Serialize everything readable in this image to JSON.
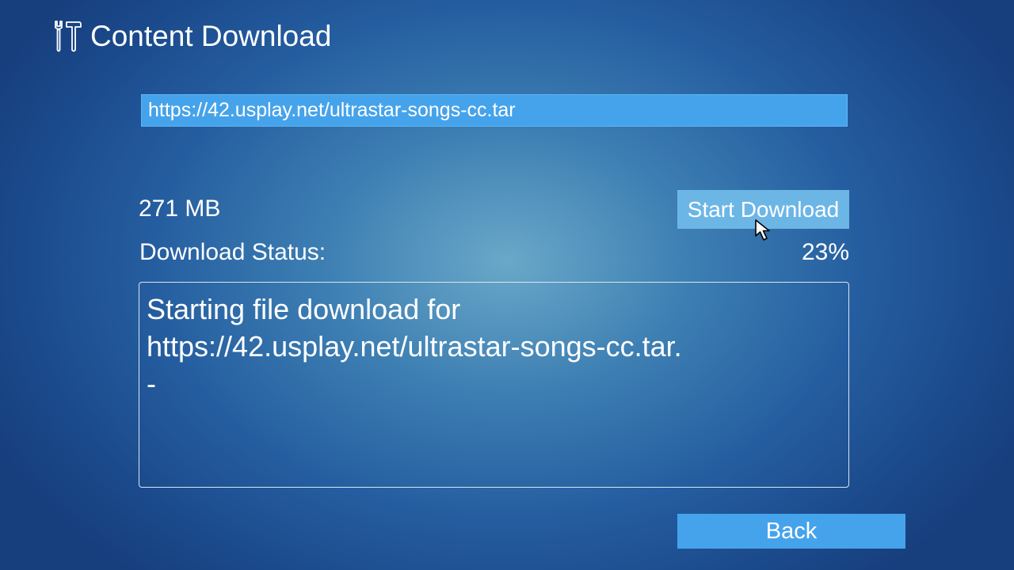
{
  "header": {
    "icon": "tools-icon",
    "title": "Content Download"
  },
  "download": {
    "url_value": "https://42.usplay.net/ultrastar-songs-cc.tar",
    "size": "271 MB",
    "start_label": "Start Download",
    "status_label": "Download Status:",
    "progress_text": "23%",
    "progress_value": 0.23,
    "log_text": "Starting file download for\nhttps://42.usplay.net/ultrastar-songs-cc.tar.\n-"
  },
  "footer": {
    "back_label": "Back"
  },
  "colors": {
    "accent": "#45a3eb",
    "button_highlight": "#6cb6e6",
    "background_center": "#6aa8c8",
    "background_edge": "#173f7e"
  },
  "cursor": {
    "icon": "mouse-pointer-icon"
  }
}
